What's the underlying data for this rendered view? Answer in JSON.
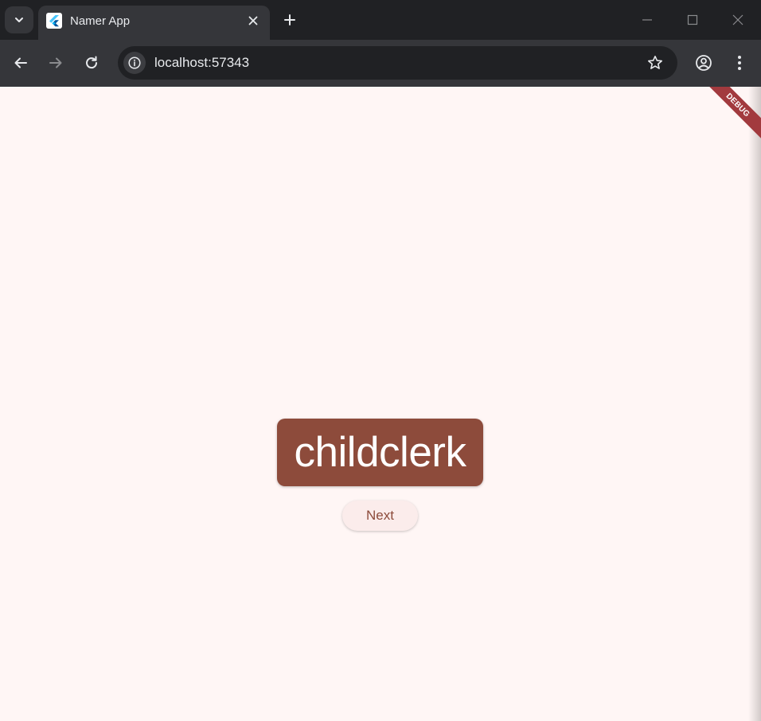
{
  "browser": {
    "tab_title": "Namer App",
    "url": "localhost:57343",
    "icons": {
      "tab_search": "chevron-down-icon",
      "favicon": "flutter-logo-icon",
      "close_tab": "close-icon",
      "new_tab": "plus-icon",
      "back": "arrow-left-icon",
      "forward": "arrow-right-icon",
      "reload": "reload-icon",
      "site_info": "info-icon",
      "bookmark": "star-icon",
      "profile": "account-circle-icon",
      "menu": "kebab-menu-icon"
    }
  },
  "app": {
    "word_pair": "childclerk",
    "next_label": "Next",
    "debug_banner": "DEBUG",
    "colors": {
      "background": "#fff6f5",
      "primary": "#8d4b3b",
      "button_bg": "#fbeceb",
      "debug_banner": "#a23a3e"
    }
  }
}
